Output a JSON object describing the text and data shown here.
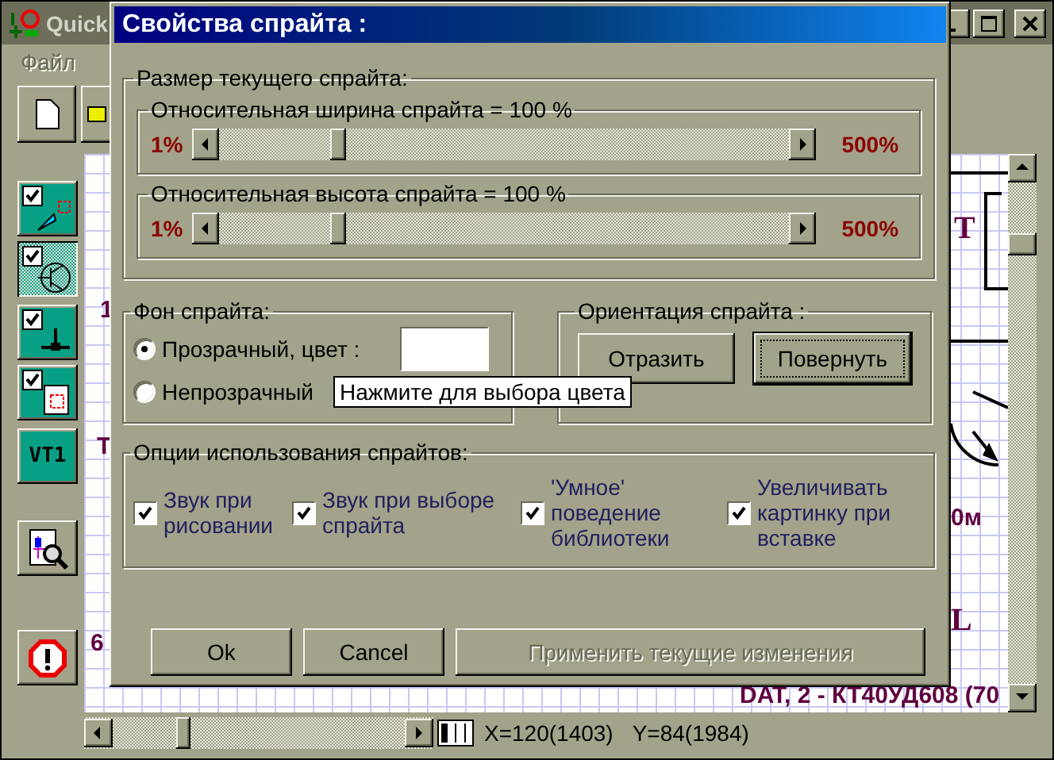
{
  "app": {
    "title": "Quick",
    "menu": [
      {
        "label": "Файл",
        "disabled": true
      }
    ]
  },
  "tools": [
    {
      "kind": "toggle",
      "checked": true,
      "selected": false
    },
    {
      "kind": "toggle",
      "checked": true,
      "selected": true
    },
    {
      "kind": "toggle",
      "checked": true,
      "selected": false
    },
    {
      "kind": "toggle",
      "checked": true,
      "selected": false
    },
    {
      "kind": "text",
      "label": "VT1"
    },
    {
      "kind": "action"
    },
    {
      "kind": "action"
    }
  ],
  "canvas_labels": [
    {
      "text": "1"
    },
    {
      "text": "Т"
    },
    {
      "text": "6"
    },
    {
      "text": "Т"
    },
    {
      "text": "0м"
    },
    {
      "text": "L"
    },
    {
      "text": "DAT, 2 - КТ40УД608 (70"
    }
  ],
  "status": {
    "x": "X=120(1403)",
    "y": "Y=84(1984)"
  },
  "dialog": {
    "title": "Свойства спрайта :",
    "size_group": {
      "label": "Размер текущего спрайта:",
      "sliders": [
        {
          "label": "Относительная ширина спрайта = 100 %",
          "min": "1%",
          "max": "500%",
          "level": 0.2
        },
        {
          "label": "Относительная высота спрайта = 100 %",
          "min": "1%",
          "max": "500%",
          "level": 0.2
        }
      ]
    },
    "background_group": {
      "label": "Фон спрайта:",
      "options": [
        {
          "label": "Прозрачный, цвет :",
          "selected": true
        },
        {
          "label": "Непрозрачный",
          "selected": false
        }
      ]
    },
    "orientation_group": {
      "label": "Ориентация спрайта :",
      "buttons": [
        {
          "label": "Отразить",
          "default": false
        },
        {
          "label": "Повернуть",
          "default": true
        }
      ]
    },
    "options_group": {
      "label": "Опции использования спрайтов:",
      "options": [
        {
          "label": "Звук при рисовании",
          "checked": true
        },
        {
          "label": "Звук при выборе спрайта",
          "checked": true
        },
        {
          "label": "'Умное' поведение библиотеки",
          "checked": true
        },
        {
          "label": "Увеличивать картинку при вставке",
          "checked": true
        }
      ]
    },
    "buttons": [
      {
        "label": "Ok",
        "disabled": false
      },
      {
        "label": "Cancel",
        "disabled": false
      },
      {
        "label": "Применить текущие изменения",
        "disabled": true
      }
    ]
  },
  "tooltip": "Нажмите для выбора цвета"
}
